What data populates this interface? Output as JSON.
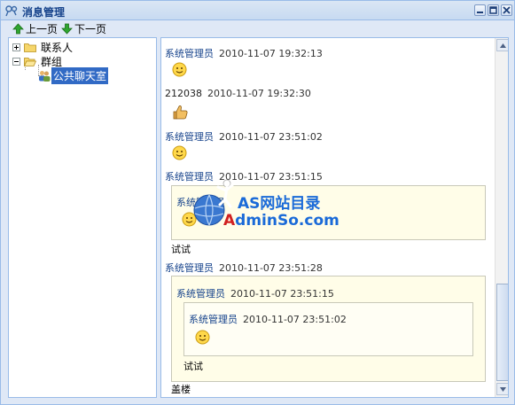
{
  "window": {
    "title": "消息管理"
  },
  "toolbar": {
    "prev_label": "上一页",
    "next_label": "下一页"
  },
  "tree": {
    "nodes": [
      {
        "label": "联系人",
        "expander": "plus"
      },
      {
        "label": "群组",
        "expander": "minus"
      },
      {
        "label": "公共聊天室",
        "selected": true
      }
    ]
  },
  "messages": [
    {
      "sender": "系统管理员",
      "time": "2010-11-07 19:32:13",
      "content_icon": "smiley-icon"
    },
    {
      "sender": "212038",
      "time": "2010-11-07 19:32:30",
      "content_icon": "thumbs-up-icon"
    },
    {
      "sender": "系统管理员",
      "time": "2010-11-07 23:51:02",
      "content_icon": "smiley-icon"
    },
    {
      "sender": "系统管理员",
      "time": "2010-11-07 23:51:15",
      "quote": {
        "sender": "系统管理员",
        "content_icon": "smiley-icon"
      },
      "text": "试试"
    },
    {
      "sender": "系统管理员",
      "time": "2010-11-07 23:51:28",
      "quote": {
        "sender": "系统管理员",
        "time": "2010-11-07 23:51:15",
        "quote": {
          "sender": "系统管理员",
          "time": "2010-11-07 23:51:02",
          "content_icon": "smiley-icon"
        },
        "text": "试试"
      },
      "text": "盖楼"
    }
  ],
  "watermark": {
    "line1": "AS网站目录",
    "line2_a": "A",
    "line2_b": "dminSo.com"
  },
  "colors": {
    "title": "#15428b",
    "border": "#99bbe8",
    "quote_bg": "#fffde8",
    "selected": "#316ac5"
  }
}
